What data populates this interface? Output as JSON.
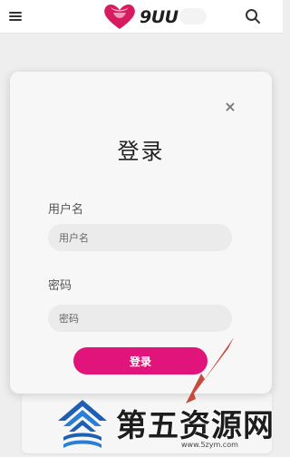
{
  "header": {
    "logo_text": "9UU"
  },
  "modal": {
    "title": "登录",
    "username_label": "用户名",
    "username_placeholder": "用户名",
    "username_value": "",
    "password_label": "密码",
    "password_placeholder": "密码",
    "password_value": "",
    "login_button": "登录",
    "close_symbol": "×"
  },
  "watermark": {
    "text": "第五资源网",
    "url": "www.5zym.com"
  },
  "colors": {
    "accent": "#e0147a",
    "logo_heart": "#d81b60"
  }
}
